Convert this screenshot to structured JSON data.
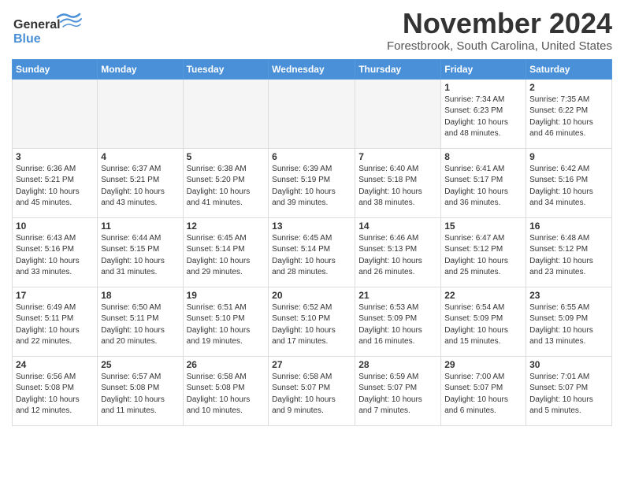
{
  "header": {
    "logo_line1": "General",
    "logo_line2": "Blue",
    "month": "November 2024",
    "location": "Forestbrook, South Carolina, United States"
  },
  "weekdays": [
    "Sunday",
    "Monday",
    "Tuesday",
    "Wednesday",
    "Thursday",
    "Friday",
    "Saturday"
  ],
  "weeks": [
    [
      {
        "day": "",
        "info": ""
      },
      {
        "day": "",
        "info": ""
      },
      {
        "day": "",
        "info": ""
      },
      {
        "day": "",
        "info": ""
      },
      {
        "day": "",
        "info": ""
      },
      {
        "day": "1",
        "info": "Sunrise: 7:34 AM\nSunset: 6:23 PM\nDaylight: 10 hours\nand 48 minutes."
      },
      {
        "day": "2",
        "info": "Sunrise: 7:35 AM\nSunset: 6:22 PM\nDaylight: 10 hours\nand 46 minutes."
      }
    ],
    [
      {
        "day": "3",
        "info": "Sunrise: 6:36 AM\nSunset: 5:21 PM\nDaylight: 10 hours\nand 45 minutes."
      },
      {
        "day": "4",
        "info": "Sunrise: 6:37 AM\nSunset: 5:21 PM\nDaylight: 10 hours\nand 43 minutes."
      },
      {
        "day": "5",
        "info": "Sunrise: 6:38 AM\nSunset: 5:20 PM\nDaylight: 10 hours\nand 41 minutes."
      },
      {
        "day": "6",
        "info": "Sunrise: 6:39 AM\nSunset: 5:19 PM\nDaylight: 10 hours\nand 39 minutes."
      },
      {
        "day": "7",
        "info": "Sunrise: 6:40 AM\nSunset: 5:18 PM\nDaylight: 10 hours\nand 38 minutes."
      },
      {
        "day": "8",
        "info": "Sunrise: 6:41 AM\nSunset: 5:17 PM\nDaylight: 10 hours\nand 36 minutes."
      },
      {
        "day": "9",
        "info": "Sunrise: 6:42 AM\nSunset: 5:16 PM\nDaylight: 10 hours\nand 34 minutes."
      }
    ],
    [
      {
        "day": "10",
        "info": "Sunrise: 6:43 AM\nSunset: 5:16 PM\nDaylight: 10 hours\nand 33 minutes."
      },
      {
        "day": "11",
        "info": "Sunrise: 6:44 AM\nSunset: 5:15 PM\nDaylight: 10 hours\nand 31 minutes."
      },
      {
        "day": "12",
        "info": "Sunrise: 6:45 AM\nSunset: 5:14 PM\nDaylight: 10 hours\nand 29 minutes."
      },
      {
        "day": "13",
        "info": "Sunrise: 6:45 AM\nSunset: 5:14 PM\nDaylight: 10 hours\nand 28 minutes."
      },
      {
        "day": "14",
        "info": "Sunrise: 6:46 AM\nSunset: 5:13 PM\nDaylight: 10 hours\nand 26 minutes."
      },
      {
        "day": "15",
        "info": "Sunrise: 6:47 AM\nSunset: 5:12 PM\nDaylight: 10 hours\nand 25 minutes."
      },
      {
        "day": "16",
        "info": "Sunrise: 6:48 AM\nSunset: 5:12 PM\nDaylight: 10 hours\nand 23 minutes."
      }
    ],
    [
      {
        "day": "17",
        "info": "Sunrise: 6:49 AM\nSunset: 5:11 PM\nDaylight: 10 hours\nand 22 minutes."
      },
      {
        "day": "18",
        "info": "Sunrise: 6:50 AM\nSunset: 5:11 PM\nDaylight: 10 hours\nand 20 minutes."
      },
      {
        "day": "19",
        "info": "Sunrise: 6:51 AM\nSunset: 5:10 PM\nDaylight: 10 hours\nand 19 minutes."
      },
      {
        "day": "20",
        "info": "Sunrise: 6:52 AM\nSunset: 5:10 PM\nDaylight: 10 hours\nand 17 minutes."
      },
      {
        "day": "21",
        "info": "Sunrise: 6:53 AM\nSunset: 5:09 PM\nDaylight: 10 hours\nand 16 minutes."
      },
      {
        "day": "22",
        "info": "Sunrise: 6:54 AM\nSunset: 5:09 PM\nDaylight: 10 hours\nand 15 minutes."
      },
      {
        "day": "23",
        "info": "Sunrise: 6:55 AM\nSunset: 5:09 PM\nDaylight: 10 hours\nand 13 minutes."
      }
    ],
    [
      {
        "day": "24",
        "info": "Sunrise: 6:56 AM\nSunset: 5:08 PM\nDaylight: 10 hours\nand 12 minutes."
      },
      {
        "day": "25",
        "info": "Sunrise: 6:57 AM\nSunset: 5:08 PM\nDaylight: 10 hours\nand 11 minutes."
      },
      {
        "day": "26",
        "info": "Sunrise: 6:58 AM\nSunset: 5:08 PM\nDaylight: 10 hours\nand 10 minutes."
      },
      {
        "day": "27",
        "info": "Sunrise: 6:58 AM\nSunset: 5:07 PM\nDaylight: 10 hours\nand 9 minutes."
      },
      {
        "day": "28",
        "info": "Sunrise: 6:59 AM\nSunset: 5:07 PM\nDaylight: 10 hours\nand 7 minutes."
      },
      {
        "day": "29",
        "info": "Sunrise: 7:00 AM\nSunset: 5:07 PM\nDaylight: 10 hours\nand 6 minutes."
      },
      {
        "day": "30",
        "info": "Sunrise: 7:01 AM\nSunset: 5:07 PM\nDaylight: 10 hours\nand 5 minutes."
      }
    ]
  ]
}
